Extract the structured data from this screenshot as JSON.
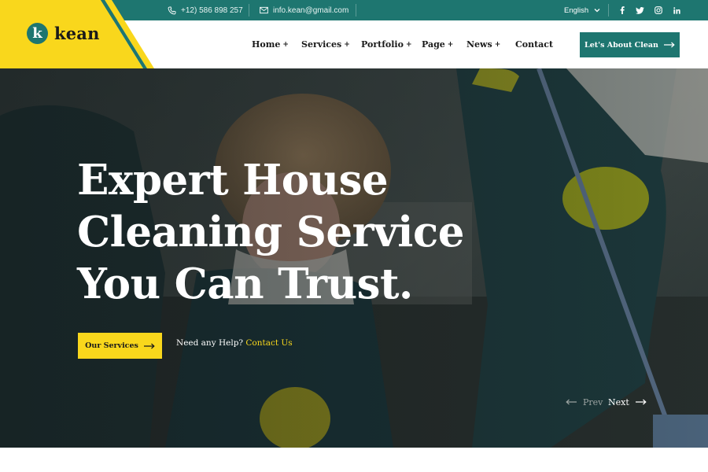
{
  "topbar": {
    "phone": "+12) 586 898 257",
    "email": "info.kean@gmail.com",
    "language": "English",
    "social": [
      "facebook-icon",
      "twitter-icon",
      "instagram-icon",
      "linkedin-icon"
    ]
  },
  "brand": {
    "logo_letter": "k",
    "name": "kean"
  },
  "nav": {
    "items": [
      {
        "label": "Home",
        "has_submenu": true
      },
      {
        "label": "Services",
        "has_submenu": true
      },
      {
        "label": "Portfolio",
        "has_submenu": true
      },
      {
        "label": "Page",
        "has_submenu": true
      },
      {
        "label": "News",
        "has_submenu": true
      },
      {
        "label": "Contact",
        "has_submenu": false
      }
    ],
    "submenu_marker": "+",
    "cta_label": "Let's About Clean"
  },
  "hero": {
    "headline_lines": [
      "Expert House",
      "Cleaning Service",
      "You Can Trust."
    ],
    "primary_button": "Our Services",
    "help_text": "Need any Help?",
    "help_link": "Contact Us",
    "prev_label": "Prev",
    "next_label": "Next"
  },
  "colors": {
    "brand_teal": "#1e7670",
    "accent_yellow": "#f9d71c",
    "text_dark": "#1a1a1a"
  }
}
